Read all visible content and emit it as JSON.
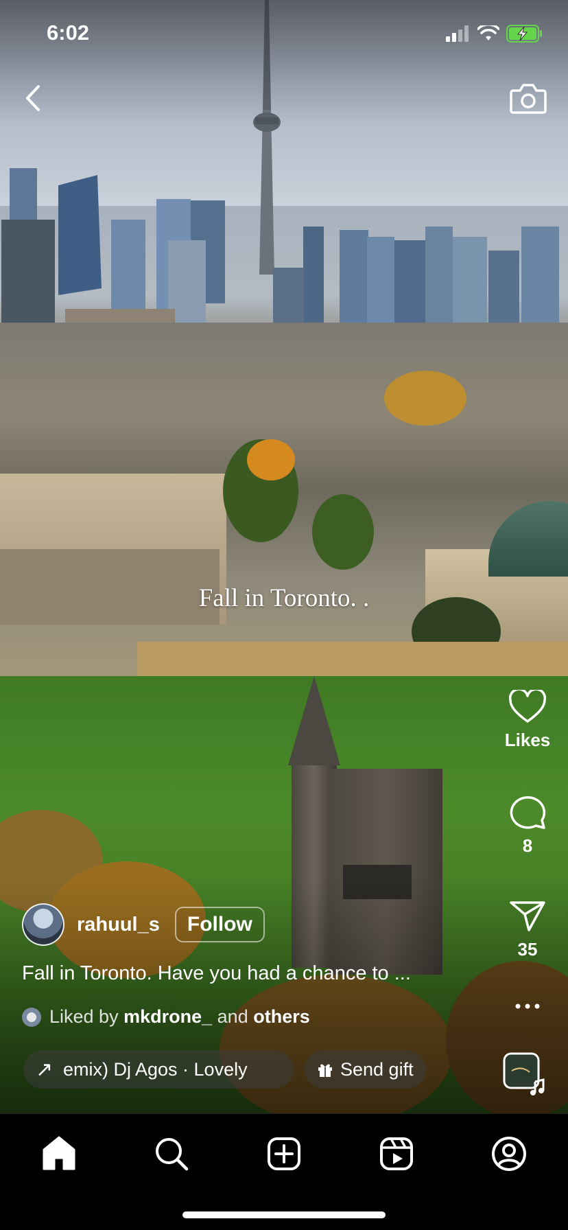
{
  "status_bar": {
    "time": "6:02"
  },
  "video": {
    "overlay_caption": "Fall in Toronto. ."
  },
  "actions": {
    "likes_label": "Likes",
    "comments_count": "8",
    "shares_count": "35",
    "more_label": "···"
  },
  "author": {
    "username": "rahuul_s",
    "follow_label": "Follow"
  },
  "caption": {
    "text": "Fall in Toronto. Have you had a chance to ..."
  },
  "liked_by": {
    "prefix": "Liked by ",
    "user": "mkdrone_",
    "middle": " and ",
    "others": "others"
  },
  "music": {
    "arrow": "↗",
    "text": "emix)   Dj Agos · Lovely"
  },
  "gift": {
    "label": "Send gift"
  },
  "tabs": [
    {
      "name": "home",
      "icon": "home-icon"
    },
    {
      "name": "search",
      "icon": "search-icon"
    },
    {
      "name": "create",
      "icon": "plus-square-icon"
    },
    {
      "name": "reels",
      "icon": "reels-icon"
    },
    {
      "name": "profile",
      "icon": "profile-icon"
    }
  ],
  "colors": {
    "overlay_text": "#ffffff",
    "battery_charging": "#65d64a",
    "tabbar_bg": "#000000"
  }
}
